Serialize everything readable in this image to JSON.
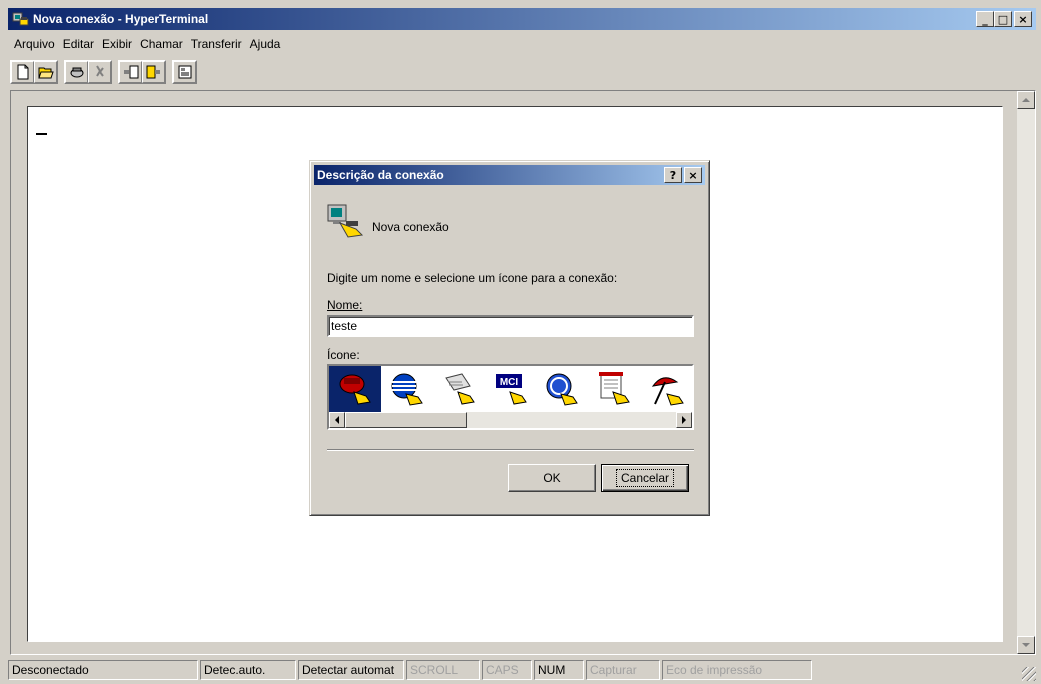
{
  "window": {
    "title": "Nova conexão - HyperTerminal",
    "min": "_",
    "max": "□",
    "close": "×"
  },
  "menu": {
    "items": [
      {
        "label": "Arquivo",
        "accel": "A"
      },
      {
        "label": "Editar",
        "accel": "E"
      },
      {
        "label": "Exibir",
        "accel": "x"
      },
      {
        "label": "Chamar",
        "accel": "C"
      },
      {
        "label": "Transferir",
        "accel": "T"
      },
      {
        "label": "Ajuda",
        "accel": "j"
      }
    ]
  },
  "toolbar": {
    "buttons": [
      "new-icon",
      "open-icon",
      "call-icon",
      "disconnect-icon",
      "send-icon",
      "receive-icon",
      "properties-icon"
    ]
  },
  "dialog": {
    "title": "Descrição da conexão",
    "help": "?",
    "close": "×",
    "connection_name": "Nova conexão",
    "prompt": "Digite um nome e selecione um ícone para a conexão:",
    "name_label": "Nome:",
    "name_value": "teste",
    "icon_label": "Ícone:",
    "icons": [
      "phone-icon",
      "globe-icon",
      "fax-icon",
      "mci-icon",
      "ge-icon",
      "notepad-icon",
      "umbrella-icon"
    ],
    "selected_icon": "phone-icon",
    "ok_label": "OK",
    "cancel_label": "Cancelar"
  },
  "status": {
    "connection": "Desconectado",
    "detect": "Detec.auto.",
    "detect2": "Detectar automat",
    "scroll": "SCROLL",
    "caps": "CAPS",
    "num": "NUM",
    "capture": "Capturar",
    "echo": "Eco de impressão"
  },
  "colors": {
    "titlebar_start": "#0a246a",
    "titlebar_end": "#a6caf0",
    "face": "#d4d0c8"
  }
}
